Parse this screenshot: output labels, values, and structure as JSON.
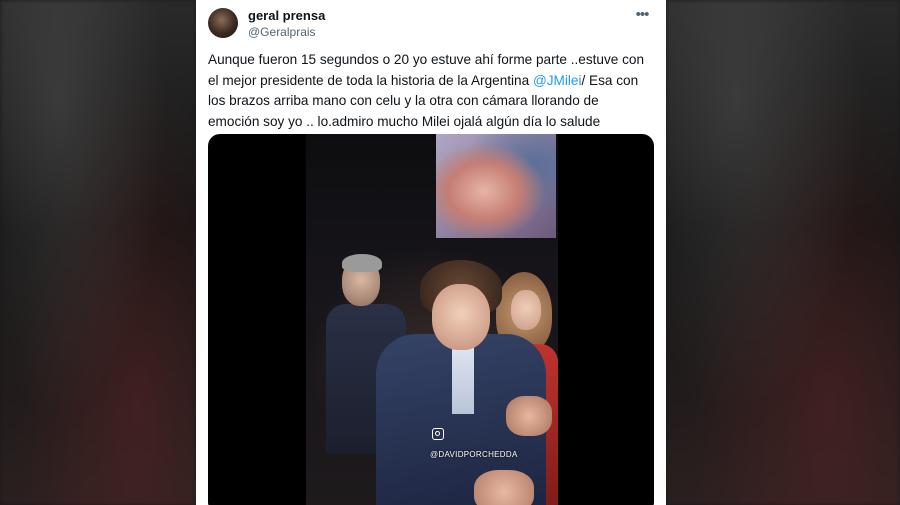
{
  "tweet": {
    "display_name": "geral prensa",
    "handle": "@Geralprais",
    "more_icon": "more-horizontal-icon",
    "text": {
      "line1": "Aunque fueron 15 segundos o 20 yo estuve ahí forme parte ..estuve con",
      "line2_before": "el mejor presidente de toda la historia de la Argentina ",
      "mention": "@JMilei",
      "line2_after": "/ Esa con",
      "line3": "los brazos arriba mano con celu y la otra con cámara llorando de",
      "line4": "emoción soy yo .. lo.admiro mucho Milei ojalá algún día lo salude"
    },
    "media": {
      "watermark_text": "@DAVIDPORCHEDDA",
      "watermark_icon": "instagram-icon"
    }
  },
  "colors": {
    "link": "#1d9bf0",
    "text": "#0f1419",
    "secondary": "#536471"
  }
}
